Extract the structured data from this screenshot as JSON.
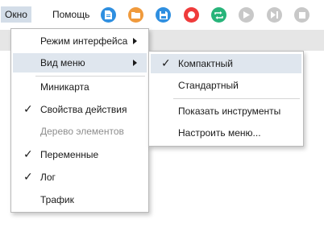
{
  "menubar": {
    "items": [
      {
        "label": "Окно",
        "active": true
      },
      {
        "label": "Помощь",
        "active": false
      }
    ]
  },
  "toolbar": {
    "buttons": [
      {
        "name": "document-icon",
        "color": "#2f8fe0"
      },
      {
        "name": "folder-icon",
        "color": "#f09a3c"
      },
      {
        "name": "save-icon",
        "color": "#2f8fe0"
      },
      {
        "name": "record-icon",
        "color": "#ef3b3b"
      },
      {
        "name": "loop-icon",
        "color": "#28b47a"
      },
      {
        "name": "play-icon",
        "color": "#c8c8c8"
      },
      {
        "name": "step-icon",
        "color": "#c8c8c8"
      },
      {
        "name": "stop-icon",
        "color": "#c8c8c8"
      }
    ]
  },
  "window_menu": {
    "items": [
      {
        "label": "Режим интерфейса",
        "submenu": true
      },
      {
        "label": "Вид меню",
        "submenu": true,
        "highlighted": true
      },
      {
        "label": "Миникарта",
        "checked": false
      },
      {
        "label": "Свойства действия",
        "checked": true
      },
      {
        "label": "Дерево элементов",
        "disabled": true
      },
      {
        "label": "Переменные",
        "checked": true
      },
      {
        "label": "Лог",
        "checked": true
      },
      {
        "label": "Трафик",
        "checked": false
      }
    ]
  },
  "menu_view_submenu": {
    "items": [
      {
        "label": "Компактный",
        "checked": true,
        "highlighted": true
      },
      {
        "label": "Стандартный",
        "checked": false
      },
      {
        "label": "Показать инструменты",
        "checked": false
      },
      {
        "label": "Настроить меню...",
        "checked": false
      }
    ]
  },
  "check_glyph": "✓"
}
